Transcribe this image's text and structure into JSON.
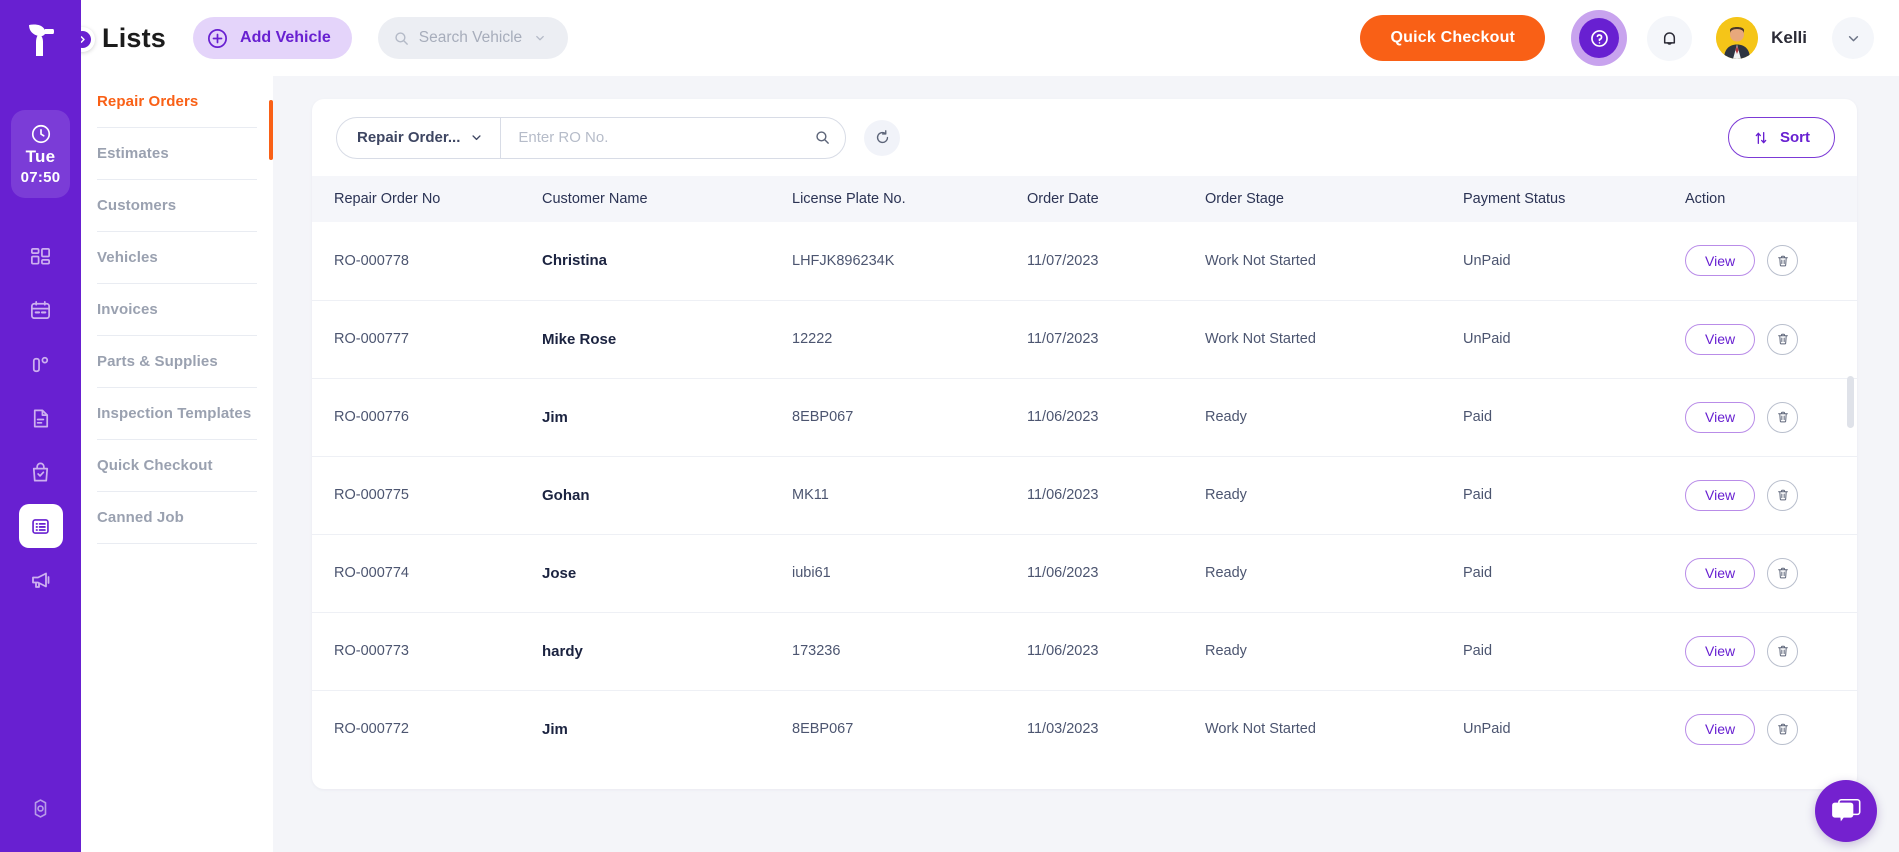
{
  "brand": {
    "logo_icon": "tekmetric-leaf-logo",
    "accent_purple": "#6820d1",
    "accent_orange": "#f96016"
  },
  "rail": {
    "clock": {
      "icon": "clock-icon",
      "day": "Tue",
      "time": "07:50"
    },
    "items": [
      {
        "name": "dashboard",
        "icon": "dashboard-grid-icon",
        "active": false
      },
      {
        "name": "calendar",
        "icon": "calendar-icon",
        "active": false
      },
      {
        "name": "parts",
        "icon": "parts-icon",
        "active": false
      },
      {
        "name": "documents",
        "icon": "document-icon",
        "active": false
      },
      {
        "name": "shop",
        "icon": "shopping-bag-check-icon",
        "active": false
      },
      {
        "name": "lists",
        "icon": "list-table-icon",
        "active": true
      },
      {
        "name": "announcements",
        "icon": "megaphone-icon",
        "active": false
      }
    ],
    "settings": {
      "name": "settings",
      "icon": "gear-icon"
    }
  },
  "topbar": {
    "collapse_icon": "chevron-right-icon",
    "title": "Lists",
    "add_vehicle_label": "Add Vehicle",
    "add_vehicle_icon": "plus-circle-icon",
    "search_vehicle_placeholder": "Search Vehicle",
    "search_vehicle_icon": "search-icon",
    "search_vehicle_caret": "chevron-down-icon",
    "quick_checkout_label": "Quick Checkout",
    "help_icon": "question-mark-icon",
    "bell_icon": "bell-icon",
    "user_name": "Kelli",
    "user_caret_icon": "chevron-down-icon",
    "avatar_icon": "user-avatar"
  },
  "nav": {
    "items": [
      {
        "label": "Repair Orders",
        "active": true
      },
      {
        "label": "Estimates",
        "active": false
      },
      {
        "label": "Customers",
        "active": false
      },
      {
        "label": "Vehicles",
        "active": false
      },
      {
        "label": "Invoices",
        "active": false
      },
      {
        "label": "Parts & Supplies",
        "active": false
      },
      {
        "label": "Inspection Templates",
        "active": false
      },
      {
        "label": "Quick Checkout",
        "active": false
      },
      {
        "label": "Canned Job",
        "active": false
      }
    ]
  },
  "toolbar": {
    "filter_label": "Repair Order...",
    "filter_caret_icon": "chevron-down-icon",
    "search_placeholder": "Enter RO No.",
    "search_value": "",
    "search_icon": "search-icon",
    "refresh_icon": "refresh-icon",
    "sort_label": "Sort",
    "sort_icon": "sort-arrows-icon"
  },
  "table": {
    "columns": [
      "Repair Order No",
      "Customer Name",
      "License Plate No.",
      "Order Date",
      "Order Stage",
      "Payment Status",
      "Action"
    ],
    "rows": [
      {
        "ro": "RO-000778",
        "customer": "Christina",
        "plate": "LHFJK896234K",
        "date": "11/07/2023",
        "stage": "Work Not Started",
        "payment": "UnPaid",
        "view_label": "View",
        "delete_icon": "trash-icon"
      },
      {
        "ro": "RO-000777",
        "customer": "Mike Rose",
        "plate": "12222",
        "date": "11/07/2023",
        "stage": "Work Not Started",
        "payment": "UnPaid",
        "view_label": "View",
        "delete_icon": "trash-icon"
      },
      {
        "ro": "RO-000776",
        "customer": "Jim",
        "plate": "8EBP067",
        "date": "11/06/2023",
        "stage": "Ready",
        "payment": "Paid",
        "view_label": "View",
        "delete_icon": "trash-icon"
      },
      {
        "ro": "RO-000775",
        "customer": "Gohan",
        "plate": "MK11",
        "date": "11/06/2023",
        "stage": "Ready",
        "payment": "Paid",
        "view_label": "View",
        "delete_icon": "trash-icon"
      },
      {
        "ro": "RO-000774",
        "customer": "Jose",
        "plate": "iubi61",
        "date": "11/06/2023",
        "stage": "Ready",
        "payment": "Paid",
        "view_label": "View",
        "delete_icon": "trash-icon"
      },
      {
        "ro": "RO-000773",
        "customer": "hardy",
        "plate": "173236",
        "date": "11/06/2023",
        "stage": "Ready",
        "payment": "Paid",
        "view_label": "View",
        "delete_icon": "trash-icon"
      },
      {
        "ro": "RO-000772",
        "customer": "Jim",
        "plate": "8EBP067",
        "date": "11/03/2023",
        "stage": "Work Not Started",
        "payment": "UnPaid",
        "view_label": "View",
        "delete_icon": "trash-icon"
      }
    ]
  },
  "chat": {
    "icon": "chat-bubbles-icon"
  }
}
